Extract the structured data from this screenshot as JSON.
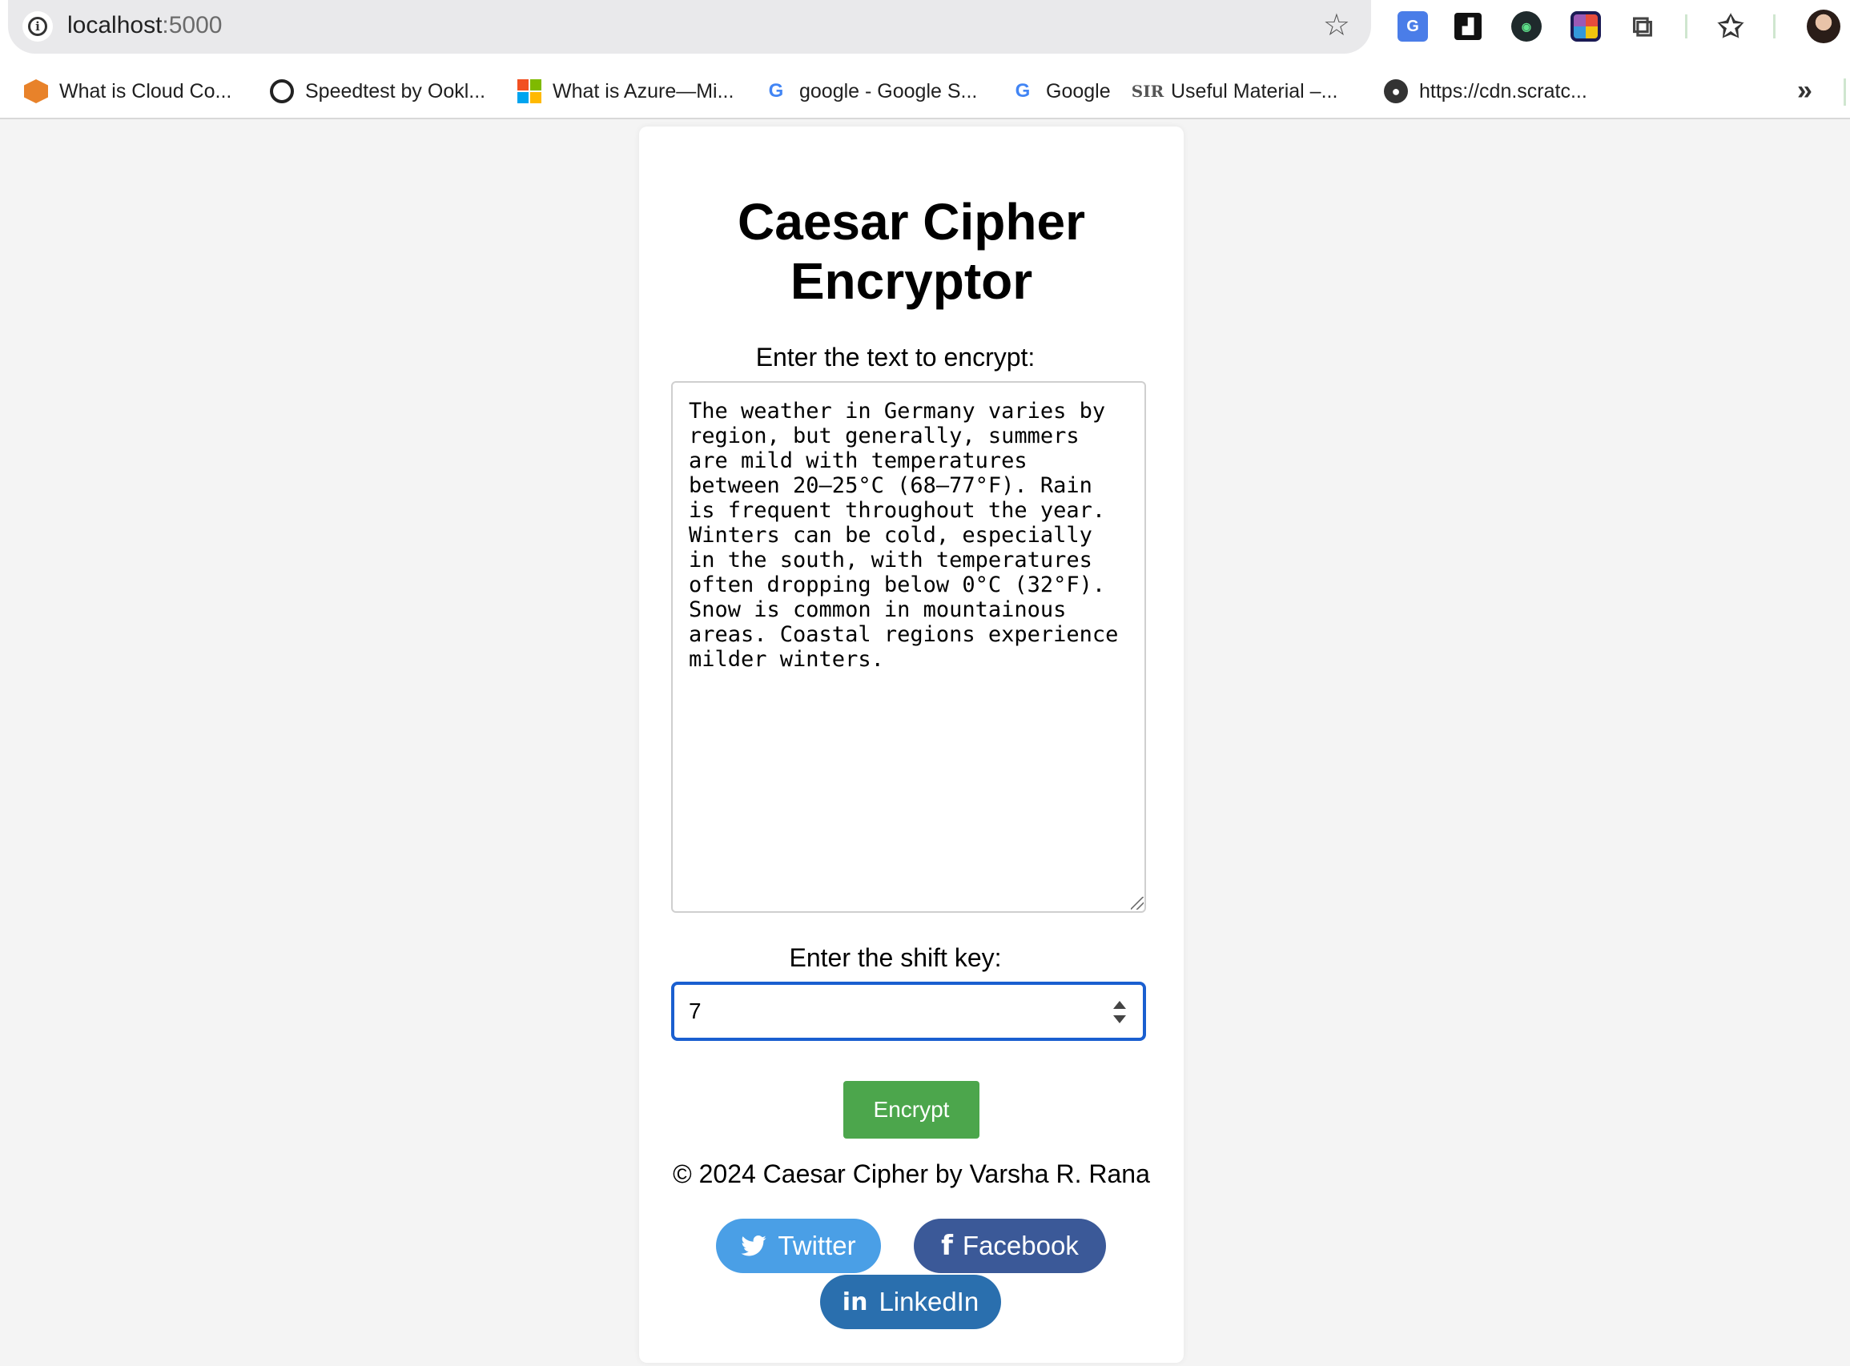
{
  "browser": {
    "url_host": "localhost",
    "url_port": ":5000",
    "bookmarks": [
      {
        "label": "What is Cloud Co...",
        "icon": "cube-icon"
      },
      {
        "label": "Speedtest by Ookl...",
        "icon": "gauge-icon"
      },
      {
        "label": "What is Azure—Mi...",
        "icon": "microsoft-icon"
      },
      {
        "label": "google - Google S...",
        "icon": "google-icon"
      },
      {
        "label": "Google",
        "icon": "google-icon"
      },
      {
        "label": "Useful Material –...",
        "icon": "sir-icon"
      },
      {
        "label": "https://cdn.scratc...",
        "icon": "globe-icon"
      }
    ]
  },
  "page": {
    "title": "Caesar Cipher Encryptor",
    "text_label": "Enter the text to encrypt:",
    "text_value": "The weather in Germany varies by region, but generally, summers are mild with temperatures between 20–25°C (68–77°F). Rain is frequent throughout the year. Winters can be cold, especially in the south, with temperatures often dropping below 0°C (32°F). Snow is common in mountainous areas. Coastal regions experience milder winters.",
    "shift_label": "Enter the shift key:",
    "shift_value": "7",
    "encrypt_label": "Encrypt",
    "footer": "© 2024 Caesar Cipher by Varsha R. Rana",
    "social": {
      "twitter": "Twitter",
      "facebook": "Facebook",
      "linkedin": "LinkedIn"
    }
  },
  "colors": {
    "encrypt": "#4ca64c",
    "twitter": "#4a9fe6",
    "facebook": "#3b5998",
    "linkedin": "#2a6fae",
    "focus": "#1a5fd0"
  }
}
